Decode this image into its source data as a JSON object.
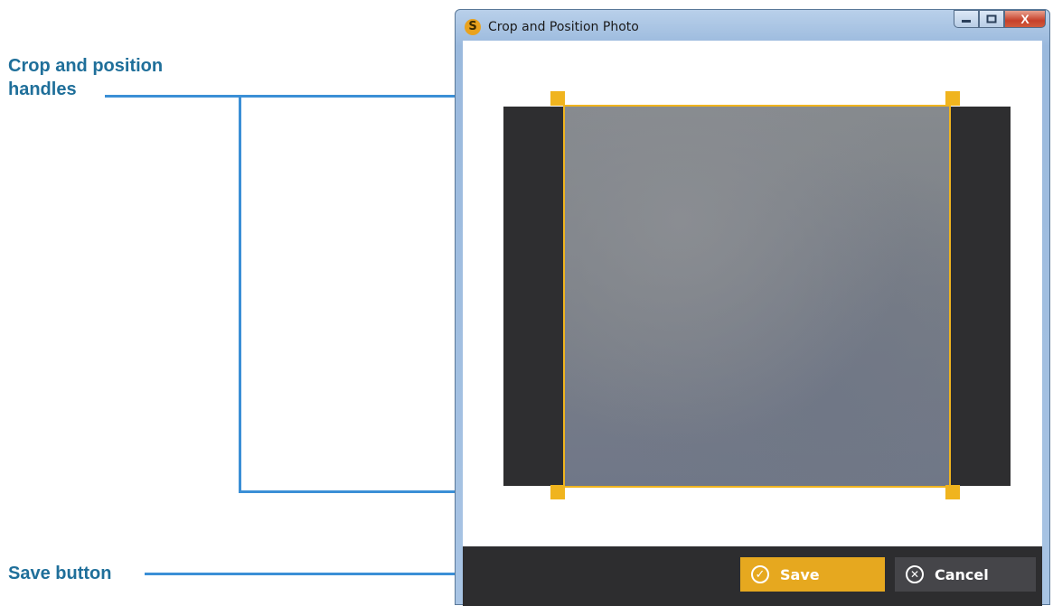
{
  "callouts": {
    "crop_handles": "Crop and position\nhandles",
    "save_button": "Save button"
  },
  "window": {
    "title": "Crop and Position Photo",
    "app_icon_glyph": "S",
    "close_glyph": "X"
  },
  "buttons": {
    "save_label": "Save",
    "cancel_label": "Cancel",
    "save_icon": "check-circle-icon",
    "cancel_icon": "x-circle-icon"
  },
  "colors": {
    "callout_text": "#1f6f9a",
    "callout_line": "#3b8fd6",
    "accent": "#f0b41e",
    "save_bg": "#e6a81f",
    "cancel_bg": "#454549",
    "bar_bg": "#2d2d2f"
  }
}
